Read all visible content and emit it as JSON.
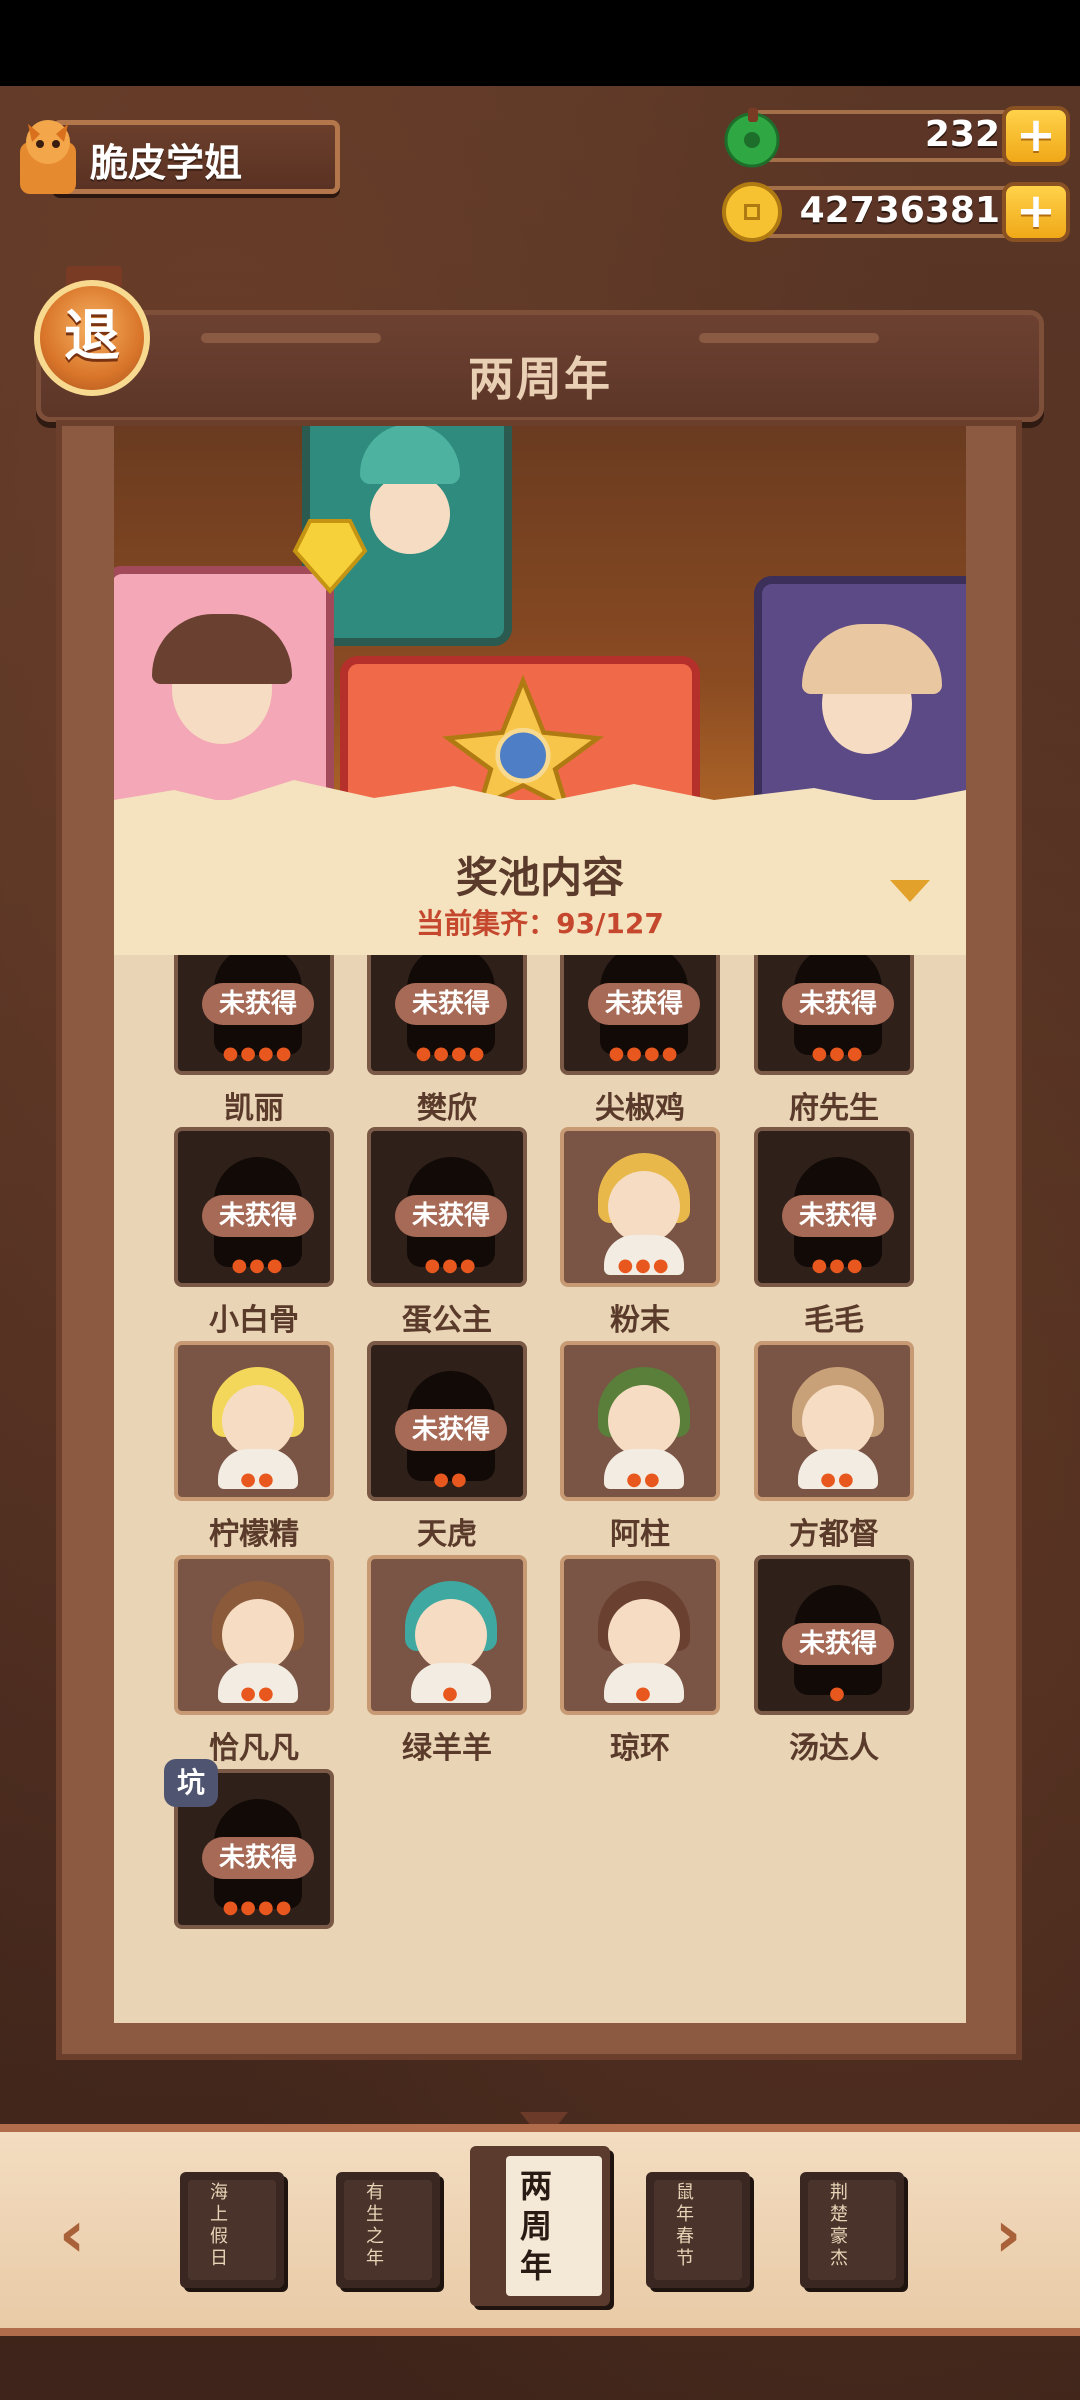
{
  "player": {
    "name": "脆皮学姐"
  },
  "currency": {
    "jade": "232",
    "coins": "42736381"
  },
  "back_label": "退",
  "title": "两周年",
  "pool": {
    "title": "奖池内容",
    "progress": "当前集齐：93/127"
  },
  "locked_label": "未获得",
  "characters": [
    {
      "name": "凯丽",
      "owned": false,
      "flames": 4
    },
    {
      "name": "樊欣",
      "owned": false,
      "flames": 4
    },
    {
      "name": "尖椒鸡",
      "owned": false,
      "flames": 4
    },
    {
      "name": "府先生",
      "owned": false,
      "flames": 3
    },
    {
      "name": "小白骨",
      "owned": false,
      "flames": 3
    },
    {
      "name": "蛋公主",
      "owned": false,
      "flames": 3
    },
    {
      "name": "粉末",
      "owned": true,
      "flames": 3
    },
    {
      "name": "毛毛",
      "owned": false,
      "flames": 3
    },
    {
      "name": "柠檬精",
      "owned": true,
      "flames": 2
    },
    {
      "name": "天虎",
      "owned": false,
      "flames": 2
    },
    {
      "name": "阿柱",
      "owned": true,
      "flames": 2
    },
    {
      "name": "方都督",
      "owned": true,
      "flames": 2
    },
    {
      "name": "恰凡凡",
      "owned": true,
      "flames": 2
    },
    {
      "name": "绿羊羊",
      "owned": true,
      "flames": 1
    },
    {
      "name": "琼环",
      "owned": true,
      "flames": 1
    },
    {
      "name": "汤达人",
      "owned": false,
      "flames": 1
    },
    {
      "name": "",
      "owned": false,
      "flames": 4,
      "tag": "坑"
    }
  ],
  "themes": [
    {
      "label": "海上假日",
      "active": false
    },
    {
      "label": "有生之年",
      "active": false
    },
    {
      "label": "两周年",
      "active": true
    },
    {
      "label": "鼠年春节",
      "active": false
    },
    {
      "label": "荆楚豪杰",
      "active": false
    }
  ],
  "nav": {
    "prev": "‹",
    "next": "›",
    "plus": "+"
  }
}
